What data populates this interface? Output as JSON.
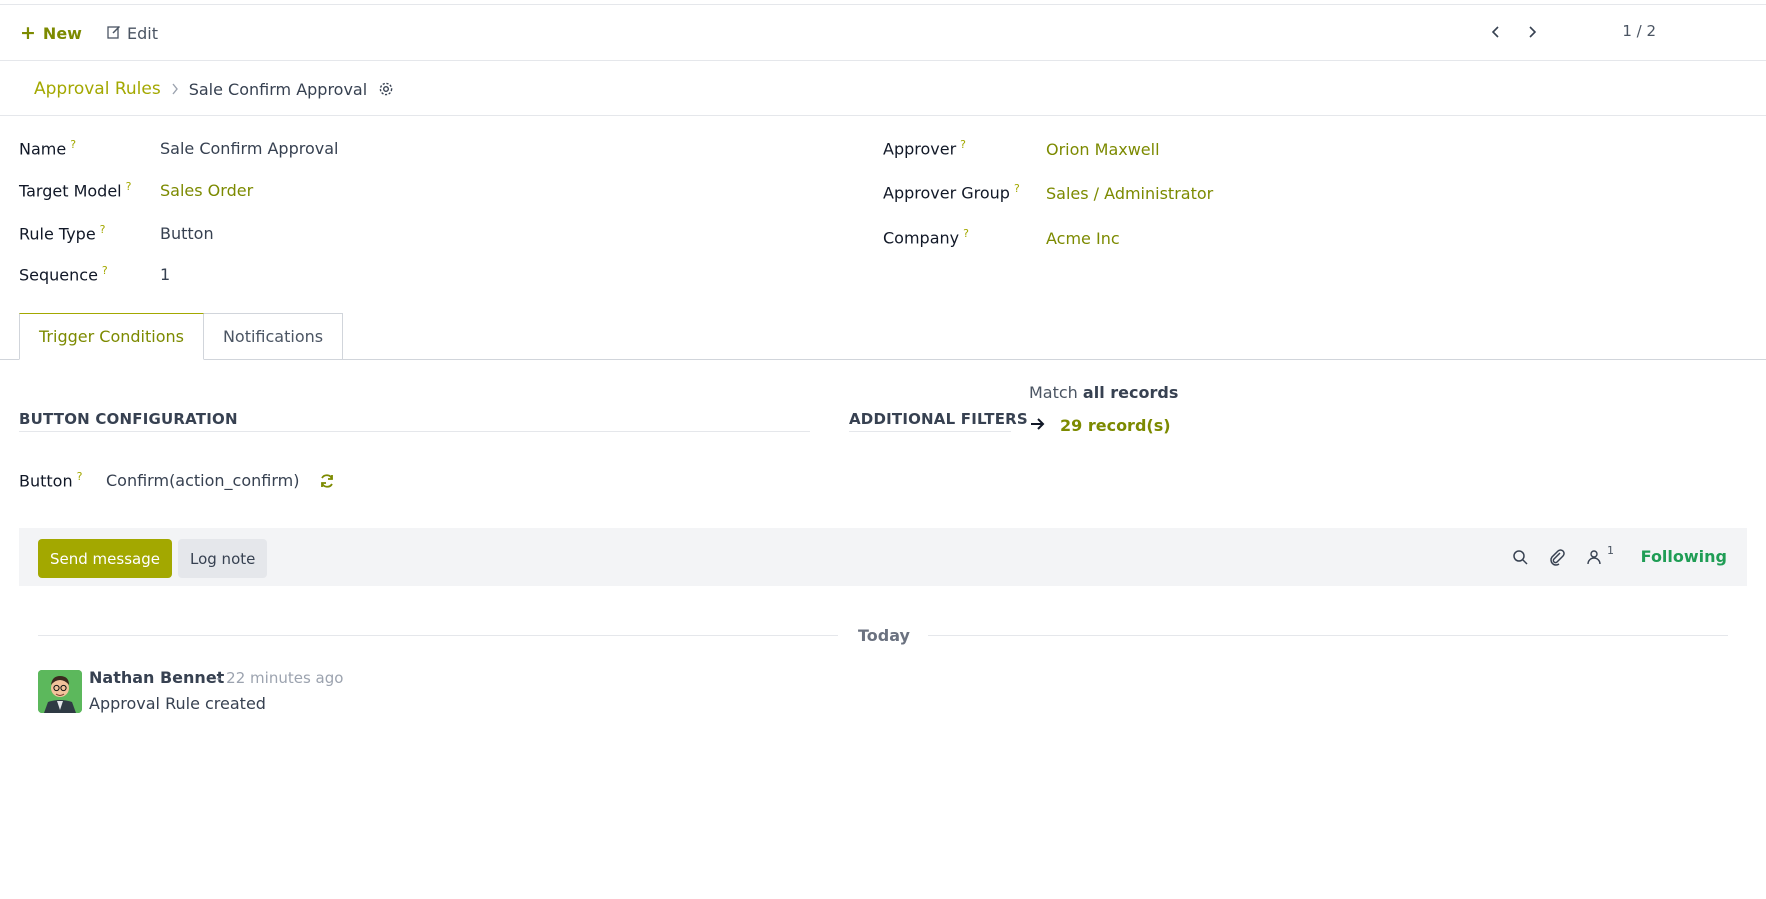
{
  "control_bar": {
    "new_label": "New",
    "edit_label": "Edit",
    "pager_text": "1 / 2"
  },
  "breadcrumb": {
    "parent": "Approval Rules",
    "current": "Sale Confirm Approval"
  },
  "fields_left": [
    {
      "label": "Name",
      "help": "?",
      "value": "Sale Confirm Approval"
    },
    {
      "label": "Target Model",
      "help": "?",
      "value": "Sales Order"
    },
    {
      "label": "Rule Type",
      "help": "?",
      "value": "Button"
    },
    {
      "label": "Sequence",
      "help": "?",
      "value": "1"
    }
  ],
  "fields_right": [
    {
      "label": "Approver",
      "help": "?",
      "value": "Orion Maxwell"
    },
    {
      "label": "Approver Group",
      "help": "?",
      "value": "Sales / Administrator"
    },
    {
      "label": "Company",
      "help": "?",
      "value": "Acme Inc"
    }
  ],
  "tabs": [
    {
      "label": "Trigger Conditions",
      "active": true
    },
    {
      "label": "Notifications",
      "active": false
    }
  ],
  "button_config": {
    "section_title": "BUTTON CONFIGURATION",
    "button_label": "Button",
    "button_help": "?",
    "button_value": "Confirm(action_confirm)"
  },
  "filters": {
    "section_title": "ADDITIONAL FILTERS",
    "match_prefix": "Match",
    "match_bold": "all records",
    "records_count": "29 record(s)"
  },
  "chatter": {
    "send_message_label": "Send message",
    "log_note_label": "Log note",
    "follower_count": "1",
    "following_label": "Following",
    "date_separator": "Today",
    "messages": [
      {
        "author": "Nathan Bennet",
        "time": "- 22 minutes ago",
        "body": "Approval Rule created"
      }
    ]
  },
  "colors": {
    "accent": "#a3a800",
    "link": "#7c8a00",
    "following": "#1f9d55"
  }
}
